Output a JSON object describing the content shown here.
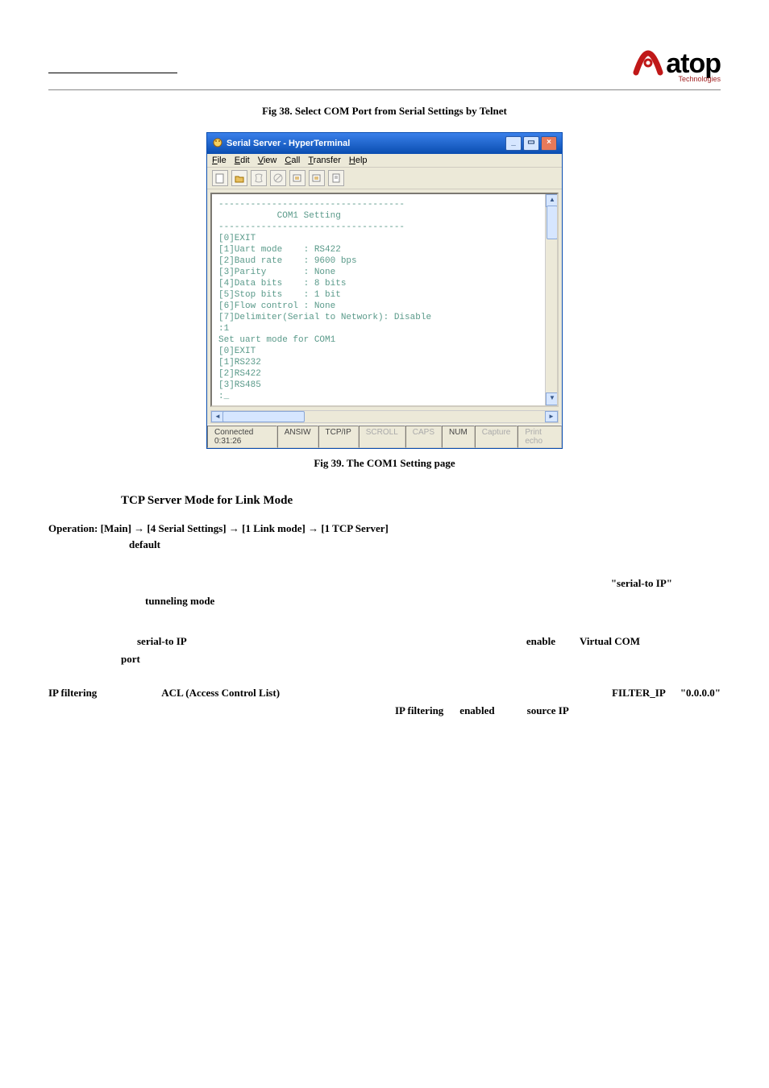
{
  "logo": {
    "main": "atop",
    "sub": "Technologies"
  },
  "fig38_caption": "Fig 38. Select COM Port from Serial Settings by Telnet",
  "fig39_caption": "Fig 39. The COM1 Setting page",
  "terminal": {
    "title": "Serial Server - HyperTerminal",
    "menu": [
      "File",
      "Edit",
      "View",
      "Call",
      "Transfer",
      "Help"
    ],
    "body_lines": [
      "-----------------------------------",
      "           COM1 Setting",
      "-----------------------------------",
      "[0]EXIT",
      "[1]Uart mode    : RS422",
      "[2]Baud rate    : 9600 bps",
      "[3]Parity       : None",
      "[4]Data bits    : 8 bits",
      "[5]Stop bits    : 1 bit",
      "[6]Flow control : None",
      "[7]Delimiter(Serial to Network): Disable",
      ":1",
      "Set uart mode for COM1",
      "[0]EXIT",
      "[1]RS232",
      "[2]RS422",
      "[3]RS485",
      ":_"
    ],
    "status": {
      "time": "Connected 0:31:26",
      "emu": "ANSIW",
      "proto": "TCP/IP",
      "scroll": "SCROLL",
      "caps": "CAPS",
      "num": "NUM",
      "capture": "Capture",
      "echo": "Print echo"
    }
  },
  "section_title": "TCP Server Mode for Link Mode",
  "operation": "Operation: [Main] → [4 Serial Settings] → [1 Link mode] → [1 TCP Server]",
  "default_word": "default",
  "serial_to_ip_quoted": "\"serial-to IP\"",
  "tunneling_mode": "tunneling mode",
  "serial_to_ip": "serial-to IP",
  "enable_word": "enable",
  "virtual_com": "Virtual COM",
  "port_word": "port",
  "ipfilter_label": "IP filtering",
  "acl_label": "ACL (Access Control List)",
  "filter_ip": "FILTER_IP",
  "zero_ip": "\"0.0.0.0\"",
  "ipfilter_label2": "IP filtering",
  "enabled_word": "enabled",
  "source_ip": "source IP"
}
